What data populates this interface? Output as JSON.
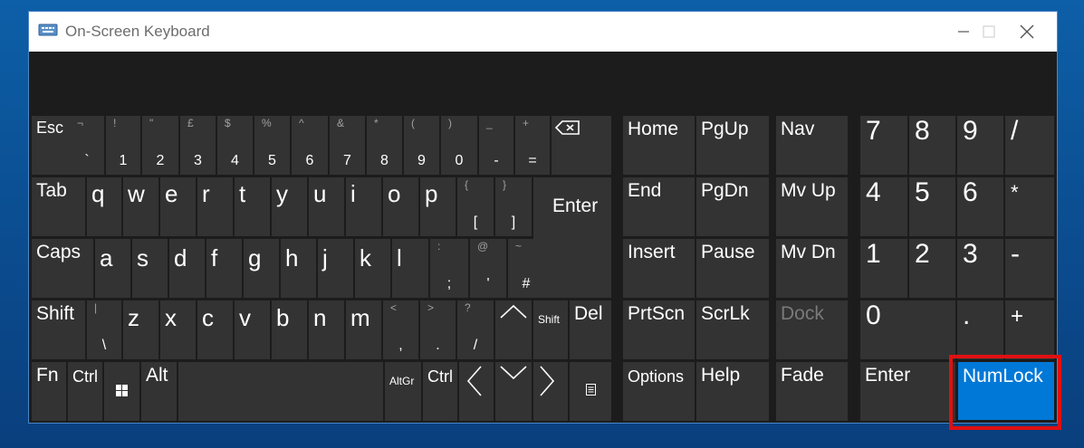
{
  "window": {
    "title": "On-Screen Keyboard"
  },
  "keys": {
    "esc": "Esc",
    "backtick_top": "¬",
    "backtick": "`",
    "n1_top": "!",
    "n1": "1",
    "n2_top": "\"",
    "n2": "2",
    "n3_top": "£",
    "n3": "3",
    "n4_top": "$",
    "n4": "4",
    "n5_top": "%",
    "n5": "5",
    "n6_top": "^",
    "n6": "6",
    "n7_top": "&",
    "n7": "7",
    "n8_top": "*",
    "n8": "8",
    "n9_top": "(",
    "n9": "9",
    "n0_top": ")",
    "n0": "0",
    "minus_top": "_",
    "minus": "-",
    "equals_top": "+",
    "equals": "=",
    "tab": "Tab",
    "q": "q",
    "w": "w",
    "e": "e",
    "r": "r",
    "t": "t",
    "y": "y",
    "u": "u",
    "i": "i",
    "o": "o",
    "p": "p",
    "lbracket_top": "{",
    "lbracket": "[",
    "rbracket_top": "}",
    "rbracket": "]",
    "enter": "Enter",
    "caps": "Caps",
    "a": "a",
    "s": "s",
    "d": "d",
    "f": "f",
    "g": "g",
    "h": "h",
    "j": "j",
    "k": "k",
    "l": "l",
    "semicolon_top": ":",
    "semicolon": ";",
    "quote_top": "@",
    "quote": "'",
    "hash_top": "~",
    "hash": "#",
    "shift": "Shift",
    "backslash_top": "|",
    "backslash": "\\",
    "z": "z",
    "x": "x",
    "c": "c",
    "v": "v",
    "b": "b",
    "n": "n",
    "m": "m",
    "comma_top": "<",
    "comma": ",",
    "period_top": ">",
    "period": ".",
    "slash_top": "?",
    "slash": "/",
    "shift_right": "Shift",
    "del": "Del",
    "fn": "Fn",
    "ctrl": "Ctrl",
    "alt": "Alt",
    "altgr": "AltGr",
    "ctrl_right": "Ctrl",
    "home": "Home",
    "pgup": "PgUp",
    "nav": "Nav",
    "end": "End",
    "pgdn": "PgDn",
    "mvup": "Mv Up",
    "insert": "Insert",
    "pause": "Pause",
    "mvdn": "Mv Dn",
    "prtscn": "PrtScn",
    "scrlk": "ScrLk",
    "dock": "Dock",
    "options": "Options",
    "help": "Help",
    "fade": "Fade",
    "np7": "7",
    "np8": "8",
    "np9": "9",
    "npdiv": "/",
    "np4": "4",
    "np5": "5",
    "np6": "6",
    "npmul": "*",
    "np1": "1",
    "np2": "2",
    "np3": "3",
    "npminus": "-",
    "np0": "0",
    "npdot": ".",
    "npplus": "+",
    "npenter": "Enter",
    "numlock": "NumLock"
  },
  "colors": {
    "key_bg": "#333333",
    "active_key": "#0078d7",
    "highlight": "#e01010",
    "window_bg": "#1c1c1c"
  }
}
